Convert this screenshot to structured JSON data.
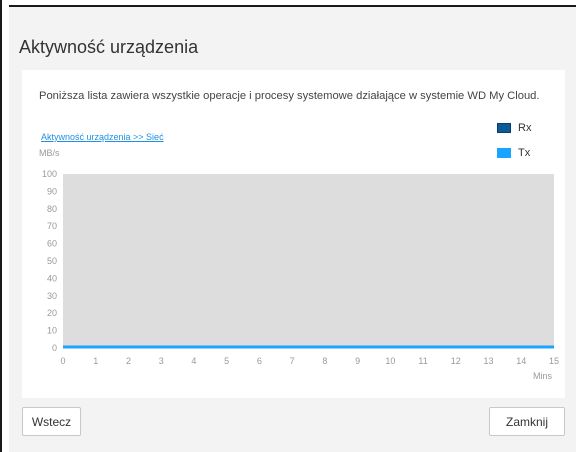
{
  "dialog": {
    "title": "Aktywność urządzenia",
    "description": "Poniższa lista zawiera wszystkie operacje i procesy systemowe działające w systemie WD My Cloud.",
    "breadcrumb_link": "Aktywność urządzenia >> Sieć",
    "back_button": "Wstecz",
    "close_button": "Zamknij"
  },
  "chart_data": {
    "type": "line",
    "ylabel": "MB/s",
    "xlabel": "Mins",
    "ylim": [
      0,
      100
    ],
    "xlim": [
      0,
      15
    ],
    "yticks": [
      0,
      10,
      20,
      30,
      40,
      50,
      60,
      70,
      80,
      90,
      100
    ],
    "xticks": [
      0,
      1,
      2,
      3,
      4,
      5,
      6,
      7,
      8,
      9,
      10,
      11,
      12,
      13,
      14,
      15
    ],
    "grid": false,
    "legend_position": "top-right",
    "series": [
      {
        "name": "Rx",
        "color": "#0e5a96",
        "x": [
          0,
          15
        ],
        "y": [
          0,
          0
        ]
      },
      {
        "name": "Tx",
        "color": "#1aa3ff",
        "x": [
          0,
          15
        ],
        "y": [
          0,
          0
        ]
      }
    ],
    "plot_background": "#dddddd"
  }
}
